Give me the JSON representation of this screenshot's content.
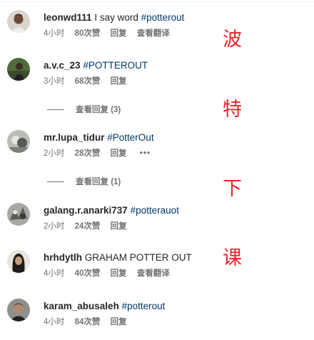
{
  "comments": [
    {
      "username": "leonwd111",
      "text": "I say word ",
      "hashtag": "#potterout",
      "time": "4小时",
      "likes": "80次赞",
      "reply": "回复",
      "translate": "查看翻译"
    },
    {
      "username": "a.v.c_23",
      "text": "",
      "hashtag": "#POTTEROUT",
      "time": "3小时",
      "likes": "68次赞",
      "reply": "回复",
      "view_replies": "查看回复 (3)"
    },
    {
      "username": "mr.lupa_tidur",
      "text": "",
      "hashtag": "#PotterOut",
      "time": "2小时",
      "likes": "28次赞",
      "reply": "回复",
      "more": "•••",
      "view_replies": "查看回复 (1)"
    },
    {
      "username": "galang.r.anarki737",
      "text": "",
      "hashtag": "#potterauot",
      "time": "2小时",
      "likes": "24次赞",
      "reply": "回复"
    },
    {
      "username": "hrhdytlh",
      "text": "GRAHAM POTTER OUT",
      "hashtag": "",
      "time": "4小时",
      "likes": "40次赞",
      "reply": "回复",
      "translate": "查看翻译"
    },
    {
      "username": "karam_abusaleh",
      "text": "",
      "hashtag": "#potterout",
      "time": "4小时",
      "likes": "84次赞",
      "reply": "回复"
    }
  ],
  "annotations": [
    "波",
    "特",
    "下",
    "课"
  ],
  "colors": {
    "hashtag": "#00376b",
    "meta": "#737373",
    "annotation": "#e8262a"
  }
}
